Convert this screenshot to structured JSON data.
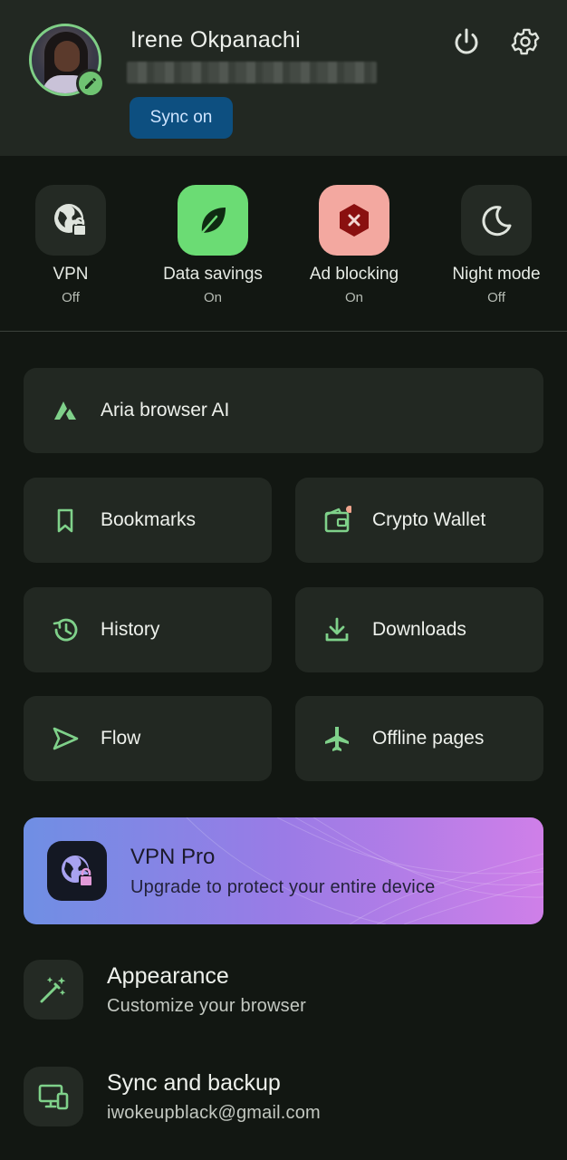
{
  "header": {
    "user_name": "Irene Okpanachi",
    "sync_label": "Sync on"
  },
  "toggles": [
    {
      "label": "VPN",
      "state": "Off"
    },
    {
      "label": "Data savings",
      "state": "On"
    },
    {
      "label": "Ad blocking",
      "state": "On"
    },
    {
      "label": "Night mode",
      "state": "Off"
    }
  ],
  "cards": {
    "aria": "Aria browser AI",
    "bookmarks": "Bookmarks",
    "crypto_wallet": "Crypto Wallet",
    "history": "History",
    "downloads": "Downloads",
    "flow": "Flow",
    "offline_pages": "Offline pages"
  },
  "promo": {
    "title": "VPN Pro",
    "subtitle": "Upgrade to protect your entire device"
  },
  "rows": {
    "appearance": {
      "title": "Appearance",
      "subtitle": "Customize your browser"
    },
    "sync": {
      "title": "Sync and backup",
      "subtitle": "iwokeupblack@gmail.com"
    }
  },
  "colors": {
    "accent_green": "#7fd18a",
    "sync_button": "#0d4f80",
    "data_savings_tile": "#6bdc74",
    "ad_blocking_tile": "#f3a8a0",
    "background": "#121712",
    "card": "#222822"
  }
}
